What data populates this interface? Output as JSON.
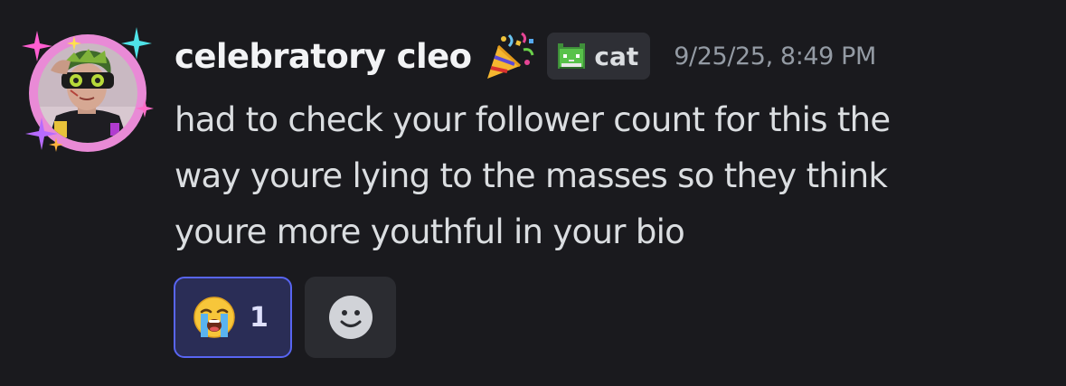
{
  "message": {
    "author": "celebratory cleo",
    "tag": {
      "label": "cat",
      "icon": "pixel-cat-icon"
    },
    "name_decoration_icon": "party-popper-icon",
    "timestamp": "9/25/25, 8:49 PM",
    "content_lines": [
      "had to check your follower count for this the",
      "way youre lying to the masses so they think",
      "youre more youthful in your bio"
    ],
    "reactions": [
      {
        "emoji": "loudly-crying-face",
        "count": "1",
        "selected": true
      }
    ],
    "add_reaction_icon": "smiley-add-reaction-icon"
  },
  "colors": {
    "background": "#1a1a1e",
    "username": "#f2f3f5",
    "text": "#dbdee1",
    "timestamp": "#949ba4",
    "tag_bg": "#2e2f35",
    "reaction_selected_bg": "#2a2d56",
    "reaction_selected_border": "#5865f2",
    "avatar_ring": "#e98ad6"
  }
}
